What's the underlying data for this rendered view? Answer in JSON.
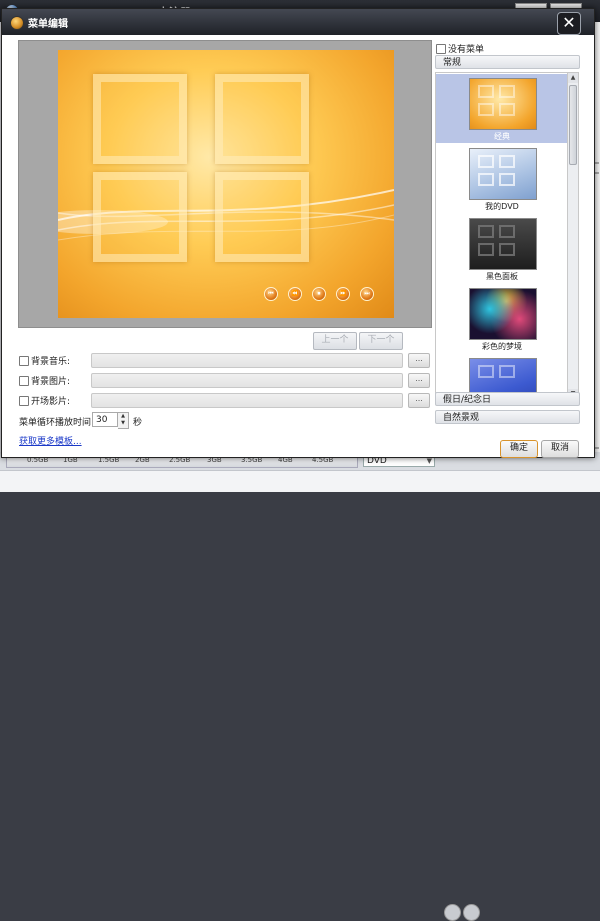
{
  "background_app": {
    "title": "Xilisoft DVD Creator (未注册)",
    "storage_ticks": [
      "0.5GB",
      "1GB",
      "1.5GB",
      "2GB",
      "2.5GB",
      "3GB",
      "3.5GB",
      "4GB",
      "4.5GB"
    ],
    "disc_type": "DVD"
  },
  "dialog": {
    "title": "菜单编辑",
    "close_symbol": "✕"
  },
  "preview": {
    "prev_label": "上一个",
    "next_label": "下一个",
    "control_icons": [
      "⏮",
      "⏪",
      "⏹",
      "⏩",
      "⏭"
    ]
  },
  "options": {
    "bg_music_label": "背景音乐:",
    "bg_image_label": "背景图片:",
    "intro_video_label": "开场影片:",
    "browse_label": "...",
    "loop_time_label": "菜单循环播放时间:",
    "loop_time_value": "30",
    "loop_time_unit": "秒",
    "more_templates_link": "获取更多模板..."
  },
  "templates": {
    "no_menu_label": "没有菜单",
    "categories": [
      "常规",
      "假日/纪念日",
      "自然景观"
    ],
    "items": [
      {
        "label": "经典",
        "selected": true
      },
      {
        "label": "我的DVD",
        "selected": false
      },
      {
        "label": "黑色面板",
        "selected": false
      },
      {
        "label": "彩色的梦境",
        "selected": false
      },
      {
        "label": "",
        "selected": false
      }
    ]
  },
  "buttons": {
    "ok_label": "确定",
    "cancel_label": "取消"
  },
  "colors": {
    "accent_orange": "#f3a52c",
    "selection_blue": "#b9c5e6",
    "link_blue": "#1b39c8"
  }
}
